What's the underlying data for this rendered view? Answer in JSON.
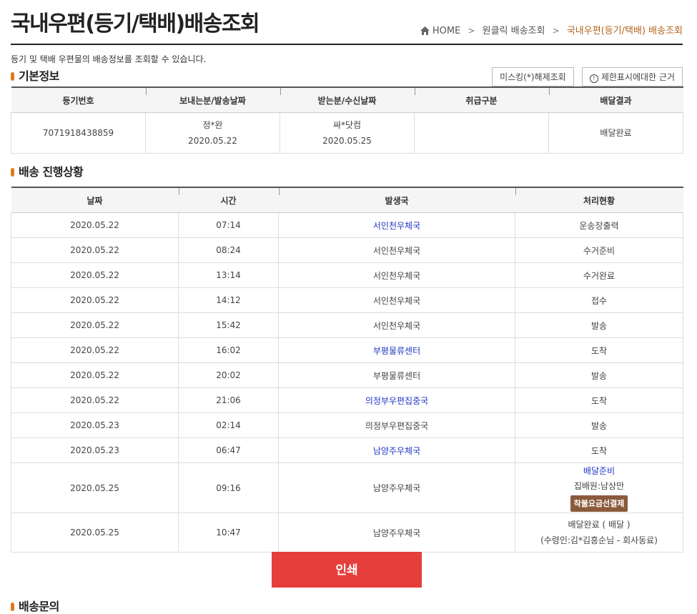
{
  "header": {
    "title": "국내우편(등기/택배)배송조회",
    "breadcrumb": [
      "HOME",
      "원클릭 배송조회",
      "국내우편(등기/택배) 배송조회"
    ]
  },
  "description": "등기 및 택배 우편물의 배송정보를 조회할 수 있습니다.",
  "basic": {
    "title": "기본정보",
    "buttons": {
      "unmask": "미스킹(*)해제조회",
      "limit": "제한표시에대한 근거"
    },
    "headers": [
      "등기번호",
      "보내는분/발송날짜",
      "받는분/수신날짜",
      "취급구분",
      "배달결과"
    ],
    "row": {
      "number": "7071918438859",
      "sender": "정*완",
      "send_date": "2020.05.22",
      "receiver": "싸*닷컴",
      "recv_date": "2020.05.25",
      "type": "",
      "result": "배달완료"
    }
  },
  "progress": {
    "title": "배송 진행상황",
    "headers": [
      "날짜",
      "시간",
      "발생국",
      "처리현황"
    ],
    "rows": [
      {
        "date": "2020.05.22",
        "time": "07:14",
        "office": "서인천우체국",
        "status": "운송장출력"
      },
      {
        "date": "2020.05.22",
        "time": "08:24",
        "office": "서인천우체국",
        "status": "수거준비"
      },
      {
        "date": "2020.05.22",
        "time": "13:14",
        "office": "서인천우체국",
        "status": "수거완료"
      },
      {
        "date": "2020.05.22",
        "time": "14:12",
        "office": "서인천우체국",
        "status": "접수"
      },
      {
        "date": "2020.05.22",
        "time": "15:42",
        "office": "서인천우체국",
        "status": "발송"
      },
      {
        "date": "2020.05.22",
        "time": "16:02",
        "office": "부평물류센터",
        "status": "도착"
      },
      {
        "date": "2020.05.22",
        "time": "20:02",
        "office": "부평물류센터",
        "status": "발송"
      },
      {
        "date": "2020.05.22",
        "time": "21:06",
        "office": "의정부우편집중국",
        "status": "도착"
      },
      {
        "date": "2020.05.23",
        "time": "02:14",
        "office": "의정부우편집중국",
        "status": "발송"
      },
      {
        "date": "2020.05.23",
        "time": "06:47",
        "office": "남양주우체국",
        "status": "도착"
      },
      {
        "date": "2020.05.25",
        "time": "09:16",
        "office": "남양주우체국",
        "status": "배달준비",
        "courier": "집배원:남상만",
        "badge": "착불요금선결제"
      },
      {
        "date": "2020.05.25",
        "time": "10:47",
        "office": "남양주우체국",
        "status": "배달완료 ( 배달 )",
        "recipient": "(수령인:김*김흥순님 - 회사동료)"
      }
    ]
  },
  "print_label": "인쇄",
  "inquiry_title": "배송문의",
  "colors": {
    "accent": "#e07a1f",
    "print": "#e53e3b",
    "link": "#2036c8",
    "badge": "#8b5a3c",
    "breadcrumb_current": "#b3651e"
  }
}
